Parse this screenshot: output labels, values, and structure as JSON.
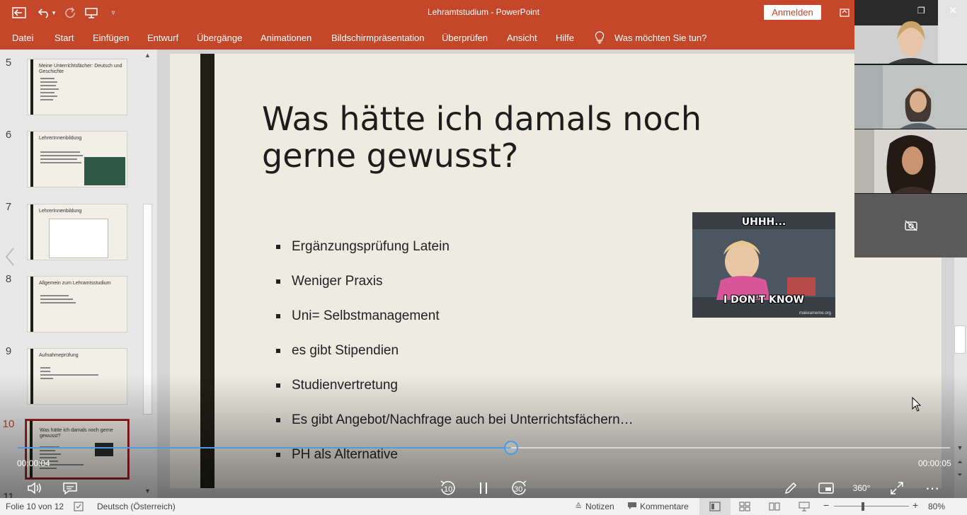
{
  "window": {
    "title": "Lehramtstudium",
    "app_name": "PowerPoint",
    "signin_label": "Anmelden"
  },
  "ribbon": {
    "tabs": [
      "Datei",
      "Start",
      "Einfügen",
      "Entwurf",
      "Übergänge",
      "Animationen",
      "Bildschirmpräsentation",
      "Überprüfen",
      "Ansicht",
      "Hilfe"
    ],
    "tell_me": "Was möchten Sie tun?"
  },
  "thumbnails": [
    {
      "number": "5",
      "title": "Meine Unterrichtsfächer: Deutsch und Geschichte"
    },
    {
      "number": "6",
      "title": "LehrerInnenbildung"
    },
    {
      "number": "7",
      "title": "LehrerInnenbildung"
    },
    {
      "number": "8",
      "title": "Allgemein zum Lehramtsstudium"
    },
    {
      "number": "9",
      "title": "Aufnahmeprüfung"
    },
    {
      "number": "10",
      "title": "Was hätte ich damals noch gerne gewusst?"
    },
    {
      "number": "11",
      "title": ""
    }
  ],
  "slide": {
    "title": "Was hätte ich damals noch gerne gewusst?",
    "bullets": [
      "Ergänzungsprüfung Latein",
      "Weniger Praxis",
      "Uni= Selbstmanagement",
      "es gibt Stipendien",
      "Studienvertretung",
      "Es gibt Angebot/Nachfrage auch bei Unterrichtsfächern…",
      "PH als Alternative"
    ],
    "meme": {
      "top_text": "UHHH...",
      "bottom_text": "I DON'T KNOW",
      "watermark": "makeameme.org"
    }
  },
  "player": {
    "current_time": "00:00:04",
    "remaining_time": "00:00:05",
    "progress": 0.529,
    "rewind_seconds": "10",
    "forward_seconds": "30",
    "vr_label": "360°"
  },
  "statusbar": {
    "slide_info": "Folie 10 von 12",
    "language": "Deutsch (Österreich)",
    "notes_label": "Notizen",
    "comments_label": "Kommentare",
    "zoom": "80%"
  },
  "colors": {
    "accent": "#c4472a",
    "seek": "#4a9be8",
    "active_thumb": "#8b1a1a"
  }
}
